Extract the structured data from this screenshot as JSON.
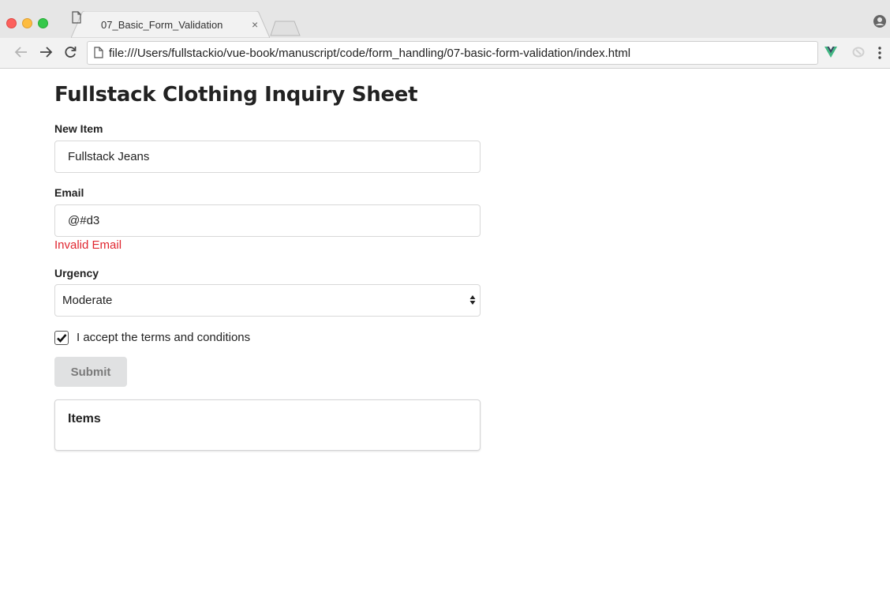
{
  "browser": {
    "tab_title": "07_Basic_Form_Validation",
    "tab_close": "×",
    "url": "file:///Users/fullstackio/vue-book/manuscript/code/form_handling/07-basic-form-validation/index.html"
  },
  "page": {
    "title": "Fullstack Clothing Inquiry Sheet"
  },
  "form": {
    "new_item": {
      "label": "New Item",
      "value": "Fullstack Jeans"
    },
    "email": {
      "label": "Email",
      "value": "@#d3",
      "error": "Invalid Email"
    },
    "urgency": {
      "label": "Urgency",
      "selected": "Moderate"
    },
    "terms": {
      "label": "I accept the terms and conditions",
      "checked": true
    },
    "submit_label": "Submit"
  },
  "items": {
    "title": "Items"
  },
  "colors": {
    "error": "#e0262f",
    "vue_green": "#41b883"
  }
}
